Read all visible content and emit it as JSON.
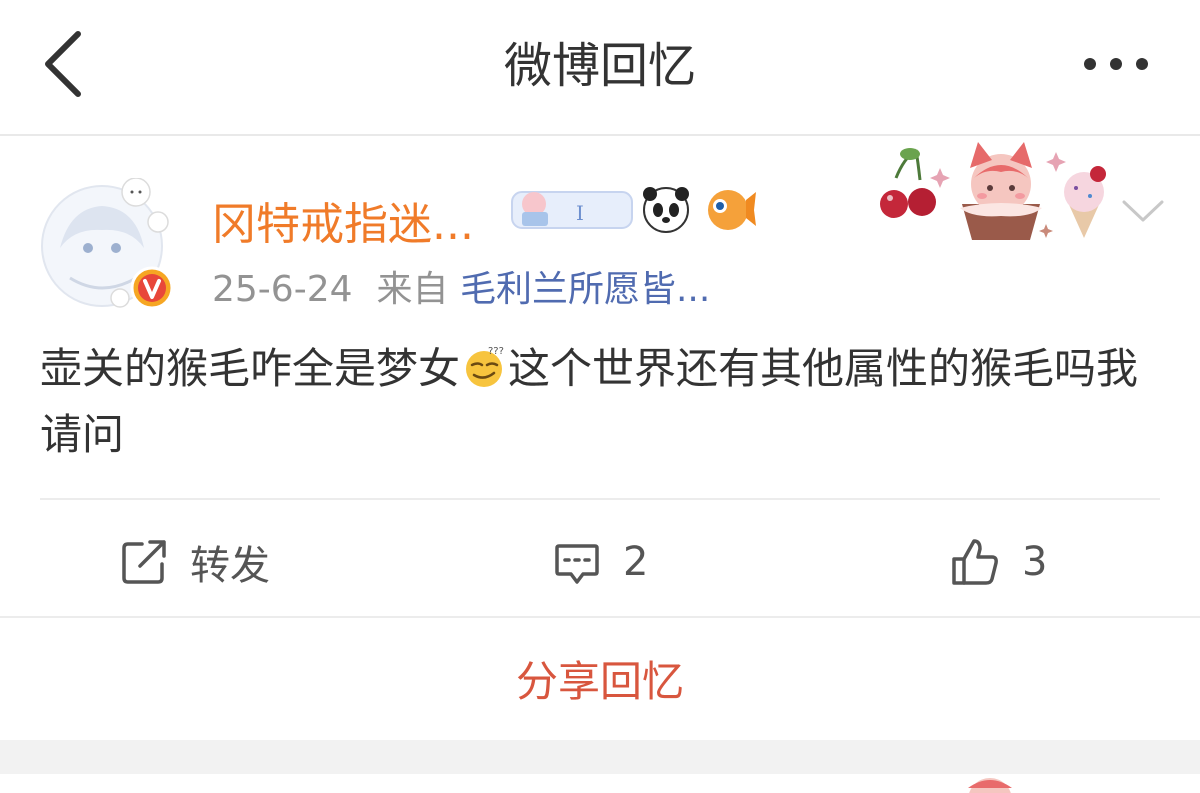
{
  "nav": {
    "title": "微博回忆",
    "back_icon": "chevron-left-icon",
    "more_icon": "more-dots-icon"
  },
  "post": {
    "username": "冈特戒指迷...",
    "date": "25-6-24",
    "from_label": "来自",
    "source": "毛利兰所愿皆...",
    "content_before": "壶关的猴毛咋全是梦女",
    "content_after": "这个世界还有其他属性的猴毛吗我请问",
    "emoji": "smirk-sweat-emoji"
  },
  "actions": {
    "repost_label": "转发",
    "comment_count": "2",
    "like_count": "3"
  },
  "share_label": "分享回忆",
  "colors": {
    "username": "#f07b29",
    "source": "#506bb0",
    "share": "#d8563e",
    "meta": "#939393"
  }
}
